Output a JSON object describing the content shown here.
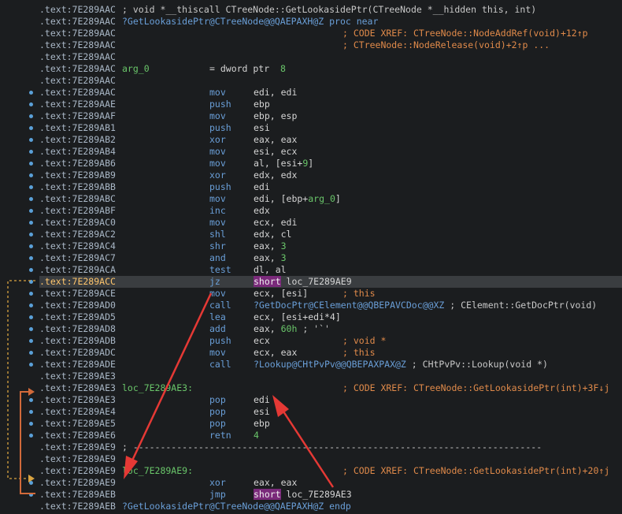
{
  "colors": {
    "background": "#1b1d1f",
    "address": "#a9b7c6",
    "mnemonic": "#6a9fd8",
    "number": "#6ac66a",
    "comment": "#e08a4a",
    "highlight": "#7a2a7a",
    "annotation_arrow": "#e53935"
  },
  "lines": [
    {
      "addr": ".text:7E289AAC",
      "text": "; void *__thiscall CTreeNode::GetLookasidePtr(CTreeNode *__hidden this, int)",
      "kind": "gray"
    },
    {
      "addr": ".text:7E289AAC",
      "text": "?GetLookasidePtr@CTreeNode@@QAEPAXH@Z proc near",
      "kind": "fn"
    },
    {
      "addr": ".text:7E289AAC",
      "comment": "; CODE XREF: CTreeNode::NodeAddRef(void)+12↑p"
    },
    {
      "addr": ".text:7E289AAC",
      "comment": "; CTreeNode::NodeRelease(void)+2↑p ..."
    },
    {
      "addr": ".text:7E289AAC"
    },
    {
      "addr": ".text:7E289AAC",
      "label": "arg_0",
      "mn": "= dword ptr",
      "arg": "8",
      "argkind": "num"
    },
    {
      "addr": ".text:7E289AAC"
    },
    {
      "addr": ".text:7E289AAC",
      "mn": "mov",
      "op": "edi, edi"
    },
    {
      "addr": ".text:7E289AAE",
      "mn": "push",
      "op": "ebp"
    },
    {
      "addr": ".text:7E289AAF",
      "mn": "mov",
      "op": "ebp, esp"
    },
    {
      "addr": ".text:7E289AB1",
      "mn": "push",
      "op": "esi"
    },
    {
      "addr": ".text:7E289AB2",
      "mn": "xor",
      "op": "eax, eax"
    },
    {
      "addr": ".text:7E289AB4",
      "mn": "mov",
      "op": "esi, ecx"
    },
    {
      "addr": ".text:7E289AB6",
      "mn": "mov",
      "op": "al, [esi+",
      "opnum": "9",
      "optail": "]"
    },
    {
      "addr": ".text:7E289AB9",
      "mn": "xor",
      "op": "edx, edx"
    },
    {
      "addr": ".text:7E289ABB",
      "mn": "push",
      "op": "edi"
    },
    {
      "addr": ".text:7E289ABC",
      "mn": "mov",
      "op": "edi, [ebp+",
      "opnum": "arg_0",
      "optail": "]"
    },
    {
      "addr": ".text:7E289ABF",
      "mn": "inc",
      "op": "edx"
    },
    {
      "addr": ".text:7E289AC0",
      "mn": "mov",
      "op": "ecx, edi"
    },
    {
      "addr": ".text:7E289AC2",
      "mn": "shl",
      "op": "edx, cl"
    },
    {
      "addr": ".text:7E289AC4",
      "mn": "shr",
      "op": "eax, ",
      "opnum": "3"
    },
    {
      "addr": ".text:7E289AC7",
      "mn": "and",
      "op": "eax, ",
      "opnum": "3"
    },
    {
      "addr": ".text:7E289ACA",
      "mn": "test",
      "op": "dl, al"
    },
    {
      "addr": ".text:7E289ACC",
      "mn": "jz",
      "hlop": "short",
      "optail": " loc_7E289AE9",
      "selected": true
    },
    {
      "addr": ".text:7E289ACE",
      "mn": "mov",
      "op": "ecx, [esi]",
      "comment": "; this"
    },
    {
      "addr": ".text:7E289AD0",
      "mn": "call",
      "call": "?GetDocPtr@CElement@@QBEPAVCDoc@@XZ",
      "calltail": " ; CElement::GetDocPtr(void)"
    },
    {
      "addr": ".text:7E289AD5",
      "mn": "lea",
      "op": "ecx, [esi+edi*4]"
    },
    {
      "addr": ".text:7E289AD8",
      "mn": "add",
      "op": "eax, ",
      "opnum": "60h",
      "optail": " ; '`'"
    },
    {
      "addr": ".text:7E289ADB",
      "mn": "push",
      "op": "ecx",
      "comment": "; void *"
    },
    {
      "addr": ".text:7E289ADC",
      "mn": "mov",
      "op": "ecx, eax",
      "comment": "; this"
    },
    {
      "addr": ".text:7E289ADE",
      "mn": "call",
      "call": "?Lookup@CHtPvPv@@QBEPAXPAX@Z",
      "calltail": " ; CHtPvPv::Lookup(void *)"
    },
    {
      "addr": ".text:7E289AE3"
    },
    {
      "addr": ".text:7E289AE3",
      "label": "loc_7E289AE3:",
      "comment": "; CODE XREF: CTreeNode::GetLookasidePtr(int)+3F↓j"
    },
    {
      "addr": ".text:7E289AE3",
      "mn": "pop",
      "op": "edi"
    },
    {
      "addr": ".text:7E289AE4",
      "mn": "pop",
      "op": "esi"
    },
    {
      "addr": ".text:7E289AE5",
      "mn": "pop",
      "op": "ebp"
    },
    {
      "addr": ".text:7E289AE6",
      "mn": "retn",
      "opnum": "4"
    },
    {
      "addr": ".text:7E289AE9",
      "text": "; ---------------------------------------------------------------------------",
      "kind": "gray"
    },
    {
      "addr": ".text:7E289AE9"
    },
    {
      "addr": ".text:7E289AE9",
      "label": "loc_7E289AE9:",
      "comment": "; CODE XREF: CTreeNode::GetLookasidePtr(int)+20↑j"
    },
    {
      "addr": ".text:7E289AE9",
      "mn": "xor",
      "op": "eax, eax"
    },
    {
      "addr": ".text:7E289AEB",
      "mn": "jmp",
      "hlop": "short",
      "optail": " loc_7E289AE3"
    },
    {
      "addr": ".text:7E289AEB",
      "text": "?GetLookasidePtr@CTreeNode@@QAEPAXH@Z endp",
      "kind": "fn"
    }
  ]
}
